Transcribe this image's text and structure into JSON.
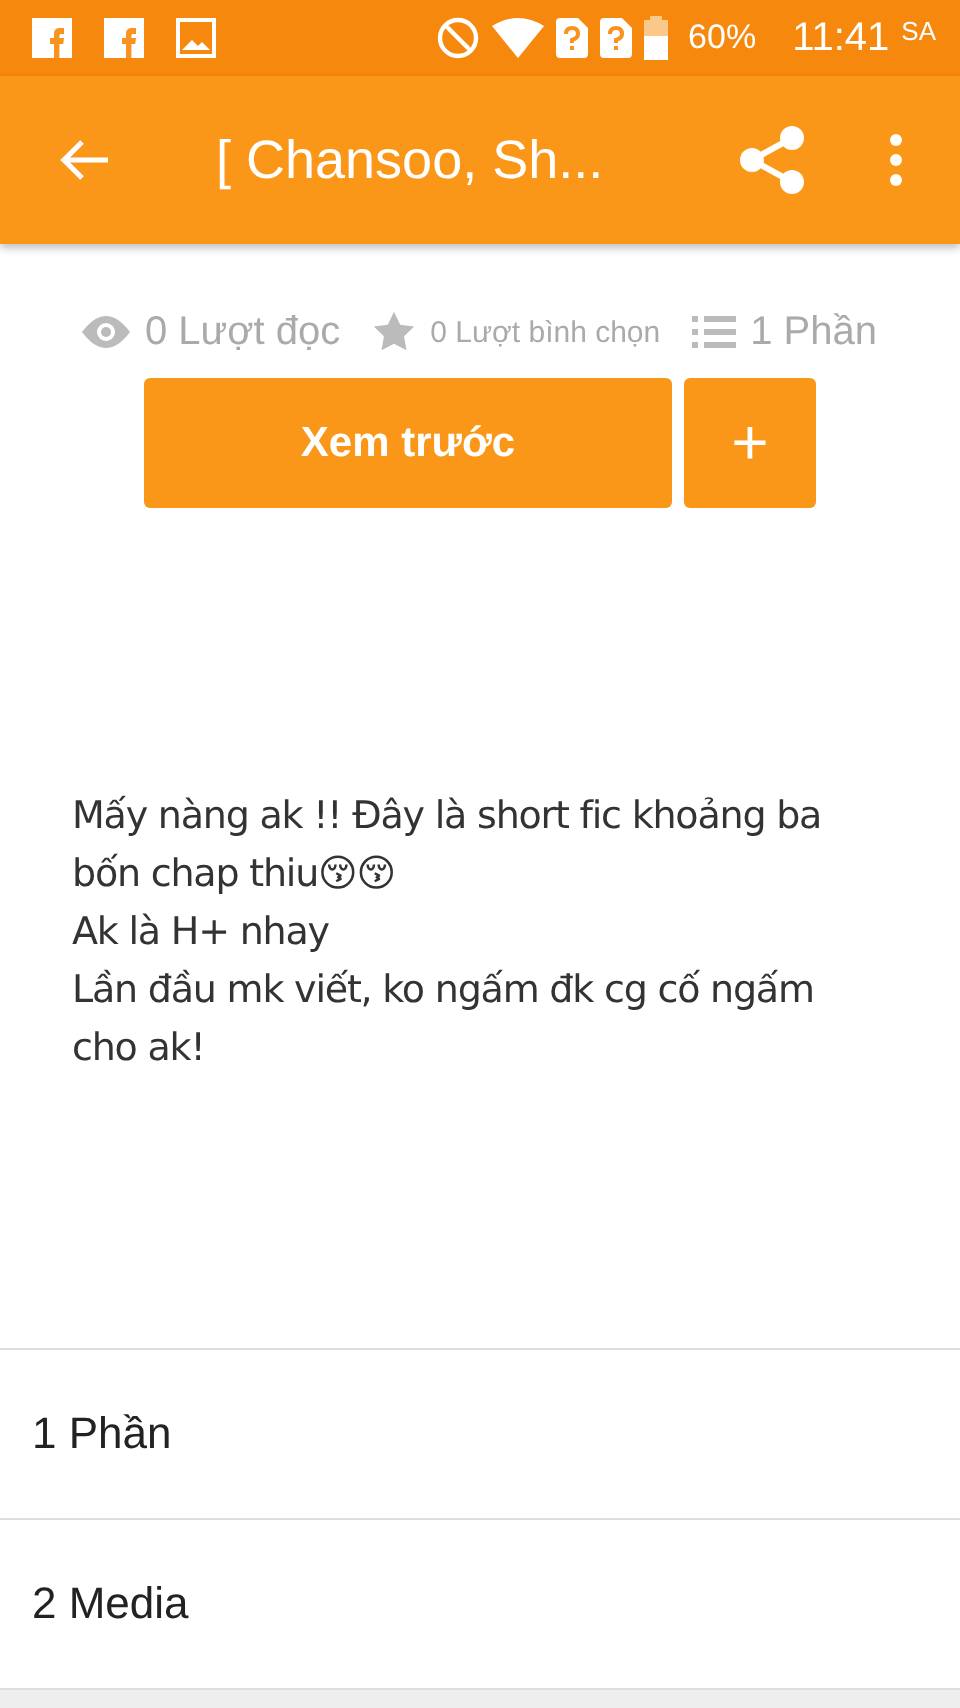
{
  "status_bar": {
    "battery": "60%",
    "time": "11:41",
    "period": "SA"
  },
  "toolbar": {
    "title": "[ Chansoo, Sh..."
  },
  "stats": [
    {
      "kind": "reads",
      "text": "0 Lượt đọc"
    },
    {
      "kind": "votes",
      "text": "0 Lượt bình chọn"
    },
    {
      "kind": "parts",
      "text": "1 Phần"
    }
  ],
  "buttons": {
    "preview": "Xem trước",
    "add": "+"
  },
  "description": [
    "Mấy nàng ak !! Đây là short fic khoảng ba bốn chap thiu😚😚",
    "Ak là H+ nhay",
    "Lần đầu mk viết, ko ngấm đk  cg cố ngấm cho ak!"
  ],
  "sections": [
    "1 Phần",
    "2 Media"
  ]
}
